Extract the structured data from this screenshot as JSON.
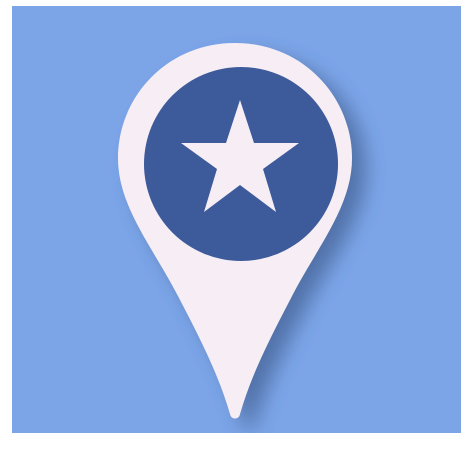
{
  "icon": {
    "name": "map-pin-star-icon",
    "background_color": "#7ca5e8",
    "pin_color": "#f7eef5",
    "inner_circle_color": "#3d5a9a",
    "star_color": "#f7eef5",
    "shadow_color": "#35507f"
  }
}
